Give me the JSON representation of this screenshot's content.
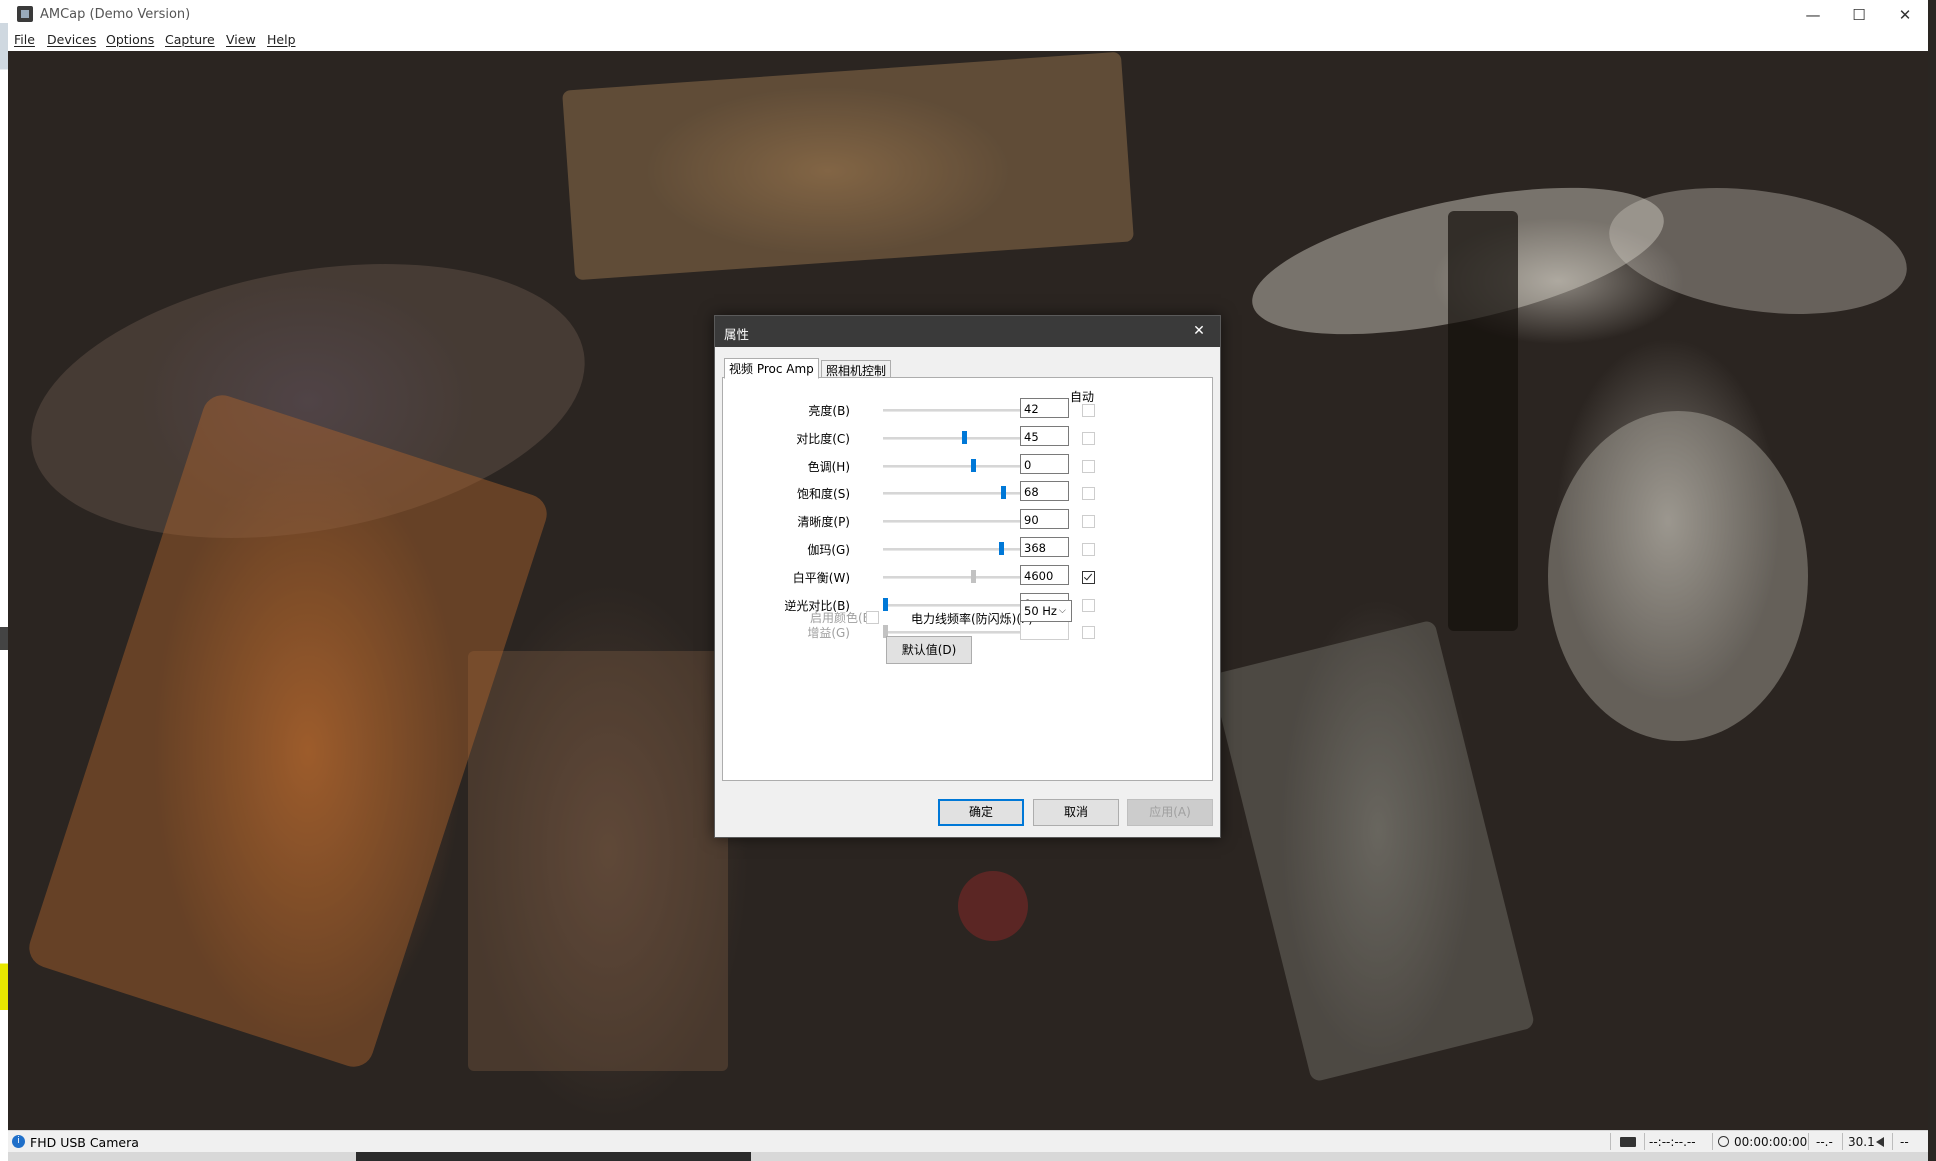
{
  "window": {
    "title": "AMCap (Demo Version)",
    "minimize": "—",
    "maximize": "☐",
    "close": "✕"
  },
  "menu": {
    "items": [
      "File",
      "Devices",
      "Options",
      "Capture",
      "View",
      "Help"
    ]
  },
  "status": {
    "icon_symbol": "i",
    "device": "FHD USB Camera",
    "dropped_frames": "--:--:--.--",
    "timer": "00:00:00:00",
    "fps_placeholder": "--.-",
    "fps": "30.1",
    "ellipsis": "--"
  },
  "dialog": {
    "title": "属性",
    "close": "✕",
    "tabs": [
      {
        "label": "视频 Proc Amp",
        "active": true
      },
      {
        "label": "照相机控制",
        "active": false
      }
    ],
    "auto_header": "自动",
    "rows": [
      {
        "label": "亮度(B)",
        "value": "42",
        "position": 0.82,
        "auto": false,
        "enabled": true
      },
      {
        "label": "对比度(C)",
        "value": "45",
        "position": 0.45,
        "auto": false,
        "enabled": true
      },
      {
        "label": "色调(H)",
        "value": "0",
        "position": 0.5,
        "auto": false,
        "enabled": true
      },
      {
        "label": "饱和度(S)",
        "value": "68",
        "position": 0.67,
        "auto": false,
        "enabled": true
      },
      {
        "label": "清晰度(P)",
        "value": "90",
        "position": 0.89,
        "auto": false,
        "enabled": true
      },
      {
        "label": "伽玛(G)",
        "value": "368",
        "position": 0.66,
        "auto": false,
        "enabled": true
      },
      {
        "label": "白平衡(W)",
        "value": "4600",
        "position": 0.5,
        "auto": true,
        "enabled": false
      },
      {
        "label": "逆光对比(B)",
        "value": "0",
        "position": 0.0,
        "auto": false,
        "enabled": true
      },
      {
        "label": "增益(G)",
        "value": "",
        "position": 0.0,
        "auto": false,
        "enabled": false
      }
    ],
    "color_enable_label": "启用颜色(E)",
    "powerline_label": "电力线频率(防闪烁)(P)",
    "powerline_value": "50 Hz",
    "powerline_chevron": "⌵",
    "default_button": "默认值(D)",
    "ok_button": "确定",
    "cancel_button": "取消",
    "apply_button": "应用(A)"
  }
}
